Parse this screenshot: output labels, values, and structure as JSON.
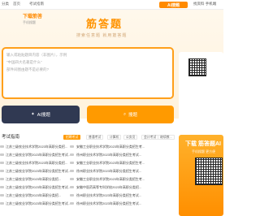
{
  "topbar": {
    "nav": [
      "分类",
      "首页",
      "考试指南"
    ],
    "ai_logo": "Ai搜题",
    "right": "找资料 手机端"
  },
  "hero": {
    "brand": "筋答题",
    "subtitle": "搜索任意题  就用筋答题",
    "placeholder": [
      "输入或粘贴题目内容（非图片），示例",
      "“中国四大名著是什么”",
      "部件间图由题不是必要的?"
    ],
    "ai_button": "AI搜题",
    "search_button": "搜题"
  },
  "download": {
    "title_prefix": "下载",
    "title_accent": "筋答",
    "subtitle": "手机搜题"
  },
  "list": {
    "title": "考试指南",
    "tabs": [
      "招聘考试",
      "普通考试",
      "计算机",
      "公务员",
      "会计考试",
      "继续教..."
    ],
    "left_rows": [
      "江苏三级农业技术学院2023年高职分类招...",
      "江苏三级农业学院2023年高职分类招生考试...",
      "江苏三级农业技术学院2023年高职分类招...",
      "江苏三级农业学院2023年高职分类招生考试...",
      "江苏三级农业学院2023年高职分类招...",
      "江苏三级农业学院2023年高职分类招生考试...",
      "江苏三级农业学院2023年高职分类招...",
      "江苏三级农业学院2023年高职分类招生考试..."
    ],
    "right_rows": [
      "安徽工业职业技术学院2023年高职分类招生考...",
      "徐州职业技术学院2023年高职分类招生考试...",
      "安徽工业职业技术学院2023年高职分类招生考...",
      "徐州职业技术学院2023年高职分类招生考试...",
      "安徽工业职业技术学院2023年高职分类招生考...",
      "安徽中医药高等专科学校2023年高职分类招...",
      "徐州职业技术学院2023年高职分类招生考试...",
      "徐州职业技术学院2023年高职分类招生考试..."
    ]
  },
  "banner": {
    "title": "下载 筋答题AI",
    "subtitle": "手机搜题 更方便"
  }
}
